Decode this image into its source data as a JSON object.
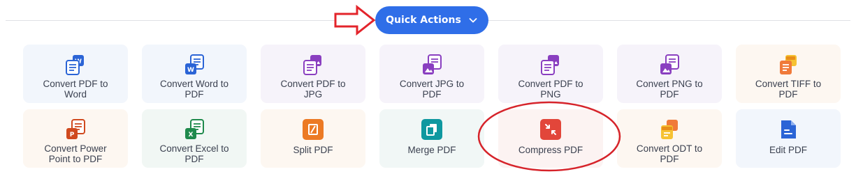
{
  "quick_actions": {
    "label": "Quick Actions"
  },
  "colors": {
    "primary": "#2f6ee8",
    "arrow": "#e3242b",
    "highlight_circle": "#d6232a",
    "card_blue": "#f2f6fc",
    "card_purple": "#f6f3fa",
    "card_orange": "#fdf7f1",
    "card_green": "#f1f7f4",
    "card_red": "#fcf3f2"
  },
  "tools": [
    {
      "label": "Convert PDF to\nWord",
      "icon": "pdf-to-word-icon"
    },
    {
      "label": "Convert Word to\nPDF",
      "icon": "word-to-pdf-icon"
    },
    {
      "label": "Convert PDF to\nJPG",
      "icon": "pdf-to-jpg-icon"
    },
    {
      "label": "Convert JPG to\nPDF",
      "icon": "jpg-to-pdf-icon"
    },
    {
      "label": "Convert PDF to\nPNG",
      "icon": "pdf-to-png-icon"
    },
    {
      "label": "Convert PNG to\nPDF",
      "icon": "png-to-pdf-icon"
    },
    {
      "label": "Convert TIFF to\nPDF",
      "icon": "tiff-to-pdf-icon"
    },
    {
      "label": "Convert Power\nPoint to PDF",
      "icon": "powerpoint-to-pdf-icon"
    },
    {
      "label": "Convert Excel to\nPDF",
      "icon": "excel-to-pdf-icon"
    },
    {
      "label": "Split PDF",
      "icon": "split-pdf-icon"
    },
    {
      "label": "Merge PDF",
      "icon": "merge-pdf-icon"
    },
    {
      "label": "Compress PDF",
      "icon": "compress-pdf-icon"
    },
    {
      "label": "Convert ODT to\nPDF",
      "icon": "odt-to-pdf-icon"
    },
    {
      "label": "Edit PDF",
      "icon": "edit-pdf-icon"
    }
  ]
}
